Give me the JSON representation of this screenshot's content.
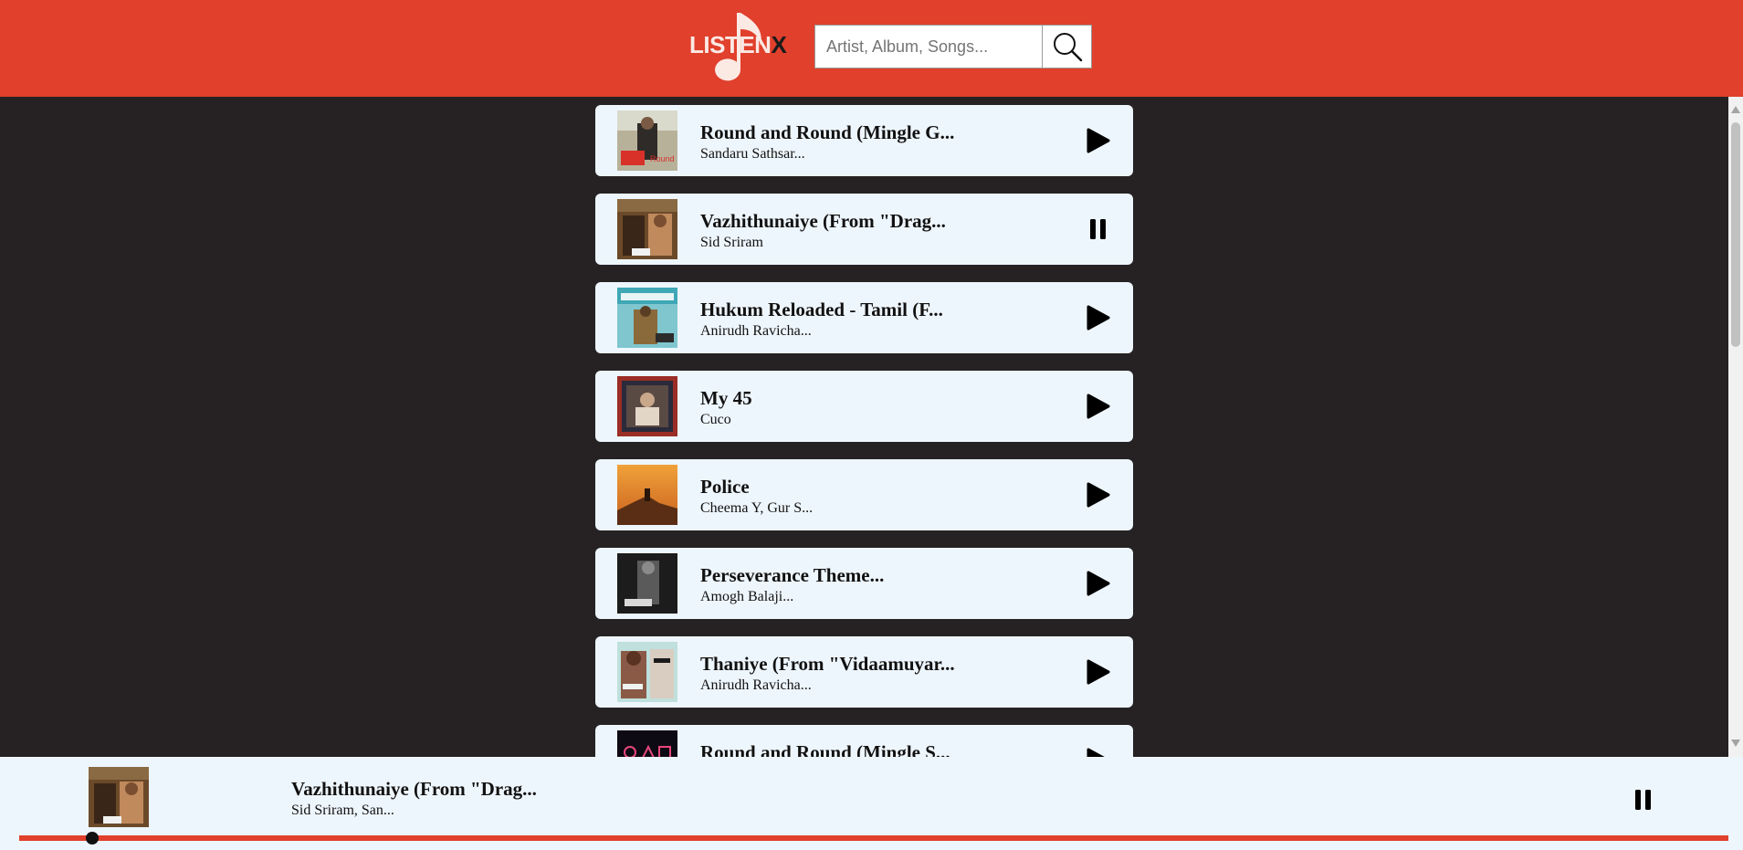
{
  "header": {
    "logo_text": "LISTEN",
    "logo_accent": "X",
    "search_placeholder": "Artist, Album, Songs...",
    "search_value": ""
  },
  "colors": {
    "brand": "#e0402c",
    "card_bg": "#eef6fd",
    "page_bg": "#262223"
  },
  "songs": [
    {
      "title": "Round and Round (Mingle G...",
      "artist": "Sandaru Sathsar...",
      "state": "play",
      "thumb": "round-and-round-cover"
    },
    {
      "title": "Vazhithunaiye (From \"Drag...",
      "artist": "Sid Sriram",
      "state": "pause",
      "thumb": "vazhithunaiye-cover"
    },
    {
      "title": "Hukum Reloaded - Tamil (F...",
      "artist": "Anirudh Ravicha...",
      "state": "play",
      "thumb": "hukum-reloaded-cover"
    },
    {
      "title": "My 45",
      "artist": "Cuco",
      "state": "play",
      "thumb": "my-45-cover"
    },
    {
      "title": "Police",
      "artist": "Cheema Y, Gur S...",
      "state": "play",
      "thumb": "police-cover"
    },
    {
      "title": "Perseverance Theme...",
      "artist": "Amogh Balaji...",
      "state": "play",
      "thumb": "perseverance-cover"
    },
    {
      "title": "Thaniye (From \"Vidaamuyar...",
      "artist": "Anirudh Ravicha...",
      "state": "play",
      "thumb": "thaniye-cover"
    },
    {
      "title": "Round and Round (Mingle S...",
      "artist": "",
      "state": "play",
      "thumb": "round-and-round-s-cover"
    }
  ],
  "player": {
    "title": "Vazhithunaiye (From \"Drag...",
    "artist": "Sid Sriram, San...",
    "state": "pause",
    "progress": 0.043,
    "thumb": "vazhithunaiye-cover"
  }
}
